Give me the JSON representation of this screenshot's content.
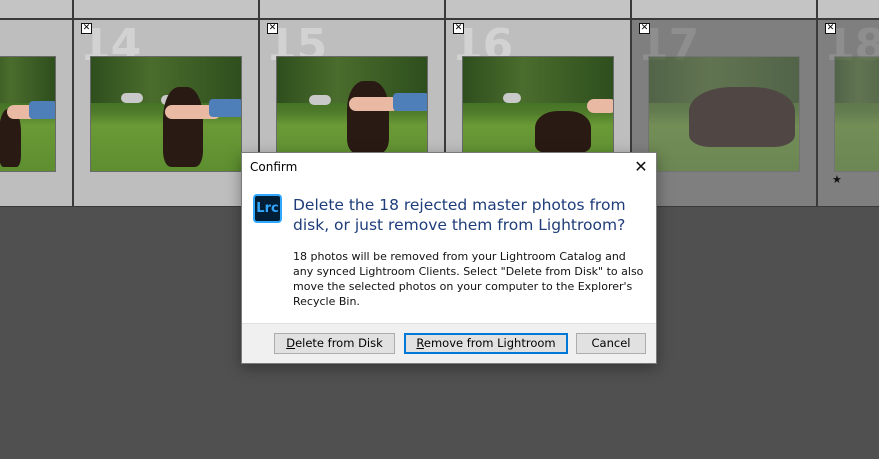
{
  "filmstrip": {
    "cells": [
      {
        "number": "",
        "rejected": false,
        "dimmed": false
      },
      {
        "number": "14",
        "rejected": true,
        "dimmed": false
      },
      {
        "number": "15",
        "rejected": true,
        "dimmed": false
      },
      {
        "number": "16",
        "rejected": true,
        "dimmed": false
      },
      {
        "number": "17",
        "rejected": true,
        "dimmed": true
      },
      {
        "number": "18",
        "rejected": true,
        "dimmed": true,
        "star": "★"
      }
    ],
    "reject_glyph": "✕"
  },
  "dialog": {
    "title": "Confirm",
    "close_glyph": "✕",
    "app_icon_label": "Lrc",
    "heading": "Delete the 18 rejected master photos from disk, or just remove them from Lightroom?",
    "body": "18 photos will be removed from your Lightroom Catalog and any synced Lightroom Clients. Select \"Delete from Disk\" to also move the selected photos on your computer to the Explorer's Recycle Bin.",
    "buttons": {
      "delete_from_disk": {
        "accel": "D",
        "rest": "elete from Disk"
      },
      "remove_from_lightroom": {
        "accel": "R",
        "rest": "emove from Lightroom"
      },
      "cancel": "Cancel"
    }
  },
  "colors": {
    "accent": "#0078d7",
    "heading": "#1f3d7a",
    "lrc_blue": "#31a8ff",
    "lrc_bg": "#001e36"
  }
}
